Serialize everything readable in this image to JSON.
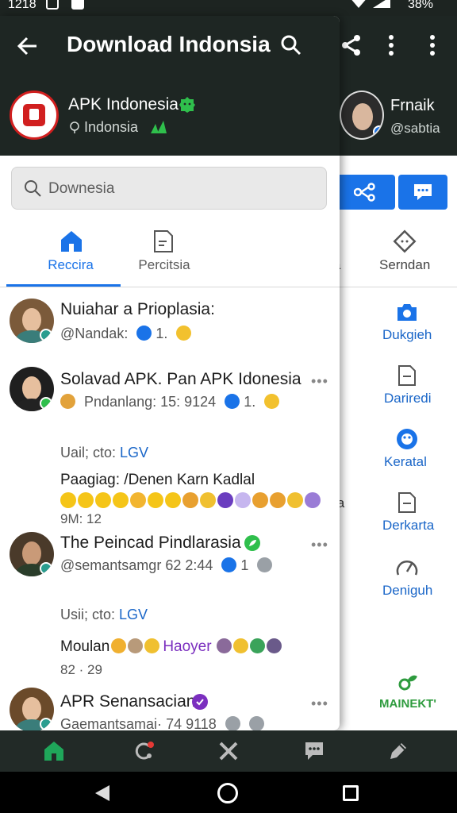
{
  "status_bar": {
    "time": "1218",
    "battery": "38%"
  },
  "header": {
    "title": "Download Indonsia",
    "channel_name": "APK Indonesia",
    "channel_region": "Indonsia"
  },
  "search": {
    "placeholder": "Downesia"
  },
  "tabs": [
    {
      "label": "Reccira",
      "active": true
    },
    {
      "label": "Percitsia",
      "active": false
    }
  ],
  "posts": [
    {
      "title": "Nuiahar a Prioplasia:",
      "meta": "@Nandak:",
      "meta_count": "1."
    },
    {
      "title": "Solavad APK. Pan APK Idonesia",
      "meta": "Pndanlang:  15: 9124",
      "meta_count": "1.",
      "info_prefix": "Uail; cto:",
      "info_highlight": "LGV",
      "body": "Paagiag: /Denen Karn Kadlal",
      "footer": "9M:  12"
    },
    {
      "title": "The Peincad Pindlarasia",
      "meta": "@semantsamgr",
      "meta_tail": "62 2:44",
      "meta_count": "1",
      "info_prefix": "Usii; cto:",
      "info_highlight": "LGV",
      "body_prefix": "Moulan",
      "body_highlight": "Haoyer",
      "footer": "82 · 29"
    },
    {
      "title": "APR Senansacian",
      "meta": "Gaemantsamai·",
      "meta_tail": "74 9118"
    }
  ],
  "back_panel": {
    "name": "Frnaik",
    "handle": "@sabtia",
    "tab_cut": "a",
    "tab_label": "Serndan",
    "side_items": [
      {
        "label": "Dukgieh",
        "icon": "camera-icon"
      },
      {
        "label": "Dariredi",
        "icon": "document-icon"
      },
      {
        "label": "Keratal",
        "icon": "smiley-icon"
      },
      {
        "label": "Derkarta",
        "icon": "document-icon"
      },
      {
        "label": "Deniguh",
        "icon": "gauge-icon"
      }
    ],
    "cut_text": "ta",
    "brand": "MAINEKT'"
  },
  "colors": {
    "header_bg": "#1e2623",
    "accent_blue": "#1a73e8",
    "verified_green": "#2fbf4c",
    "logo_red": "#d11f1f",
    "nav_active": "#1fa65a"
  }
}
